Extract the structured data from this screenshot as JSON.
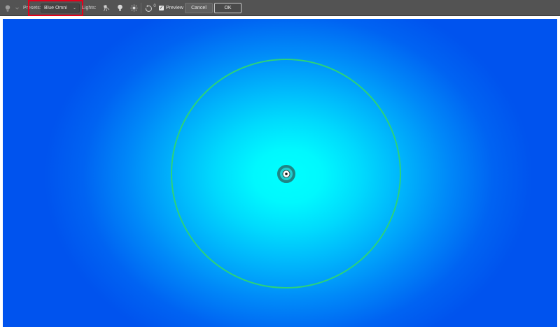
{
  "toolbar": {
    "presets_label": "Presets:",
    "presets_value": "Blue Omni",
    "lights_label": "Lights:",
    "reset_label": "0",
    "preview_label": "Preview",
    "preview_checked": true,
    "cancel_label": "Cancel",
    "ok_label": "OK",
    "icons": [
      "lightbulb-tool-icon",
      "chevron-down-icon",
      "spot-light-icon",
      "point-light-icon",
      "infinite-light-icon",
      "reset-rotate-icon"
    ],
    "highlight_color": "#e3001b"
  },
  "canvas": {
    "light_type": "Omni",
    "colors": {
      "center": "#00ffff",
      "edge": "#0053ee",
      "ring": "#2bd27a",
      "handle": "#1a8a8a"
    }
  }
}
